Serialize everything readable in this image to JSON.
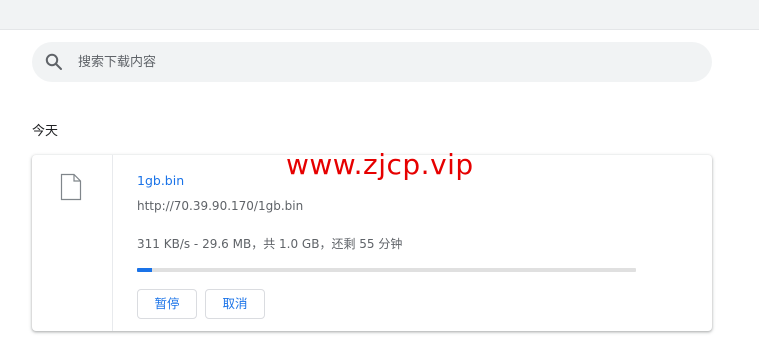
{
  "search": {
    "placeholder": "搜索下载内容"
  },
  "section": {
    "heading": "今天"
  },
  "download": {
    "file_name": "1gb.bin",
    "url": "http://70.39.90.170/1gb.bin",
    "status": "311 KB/s - 29.6 MB，共 1.0 GB，还剩 55 分钟",
    "progress_fraction": 0.0296,
    "pause_label": "暂停",
    "cancel_label": "取消"
  },
  "watermark": {
    "text": "www.zjcp.vip"
  },
  "colors": {
    "accent": "#1a73e8",
    "watermark": "#e60000",
    "secondary_text": "#5f6368",
    "search_bg": "#f1f3f4"
  },
  "icons": {
    "search": "search-icon",
    "file": "file-icon"
  }
}
